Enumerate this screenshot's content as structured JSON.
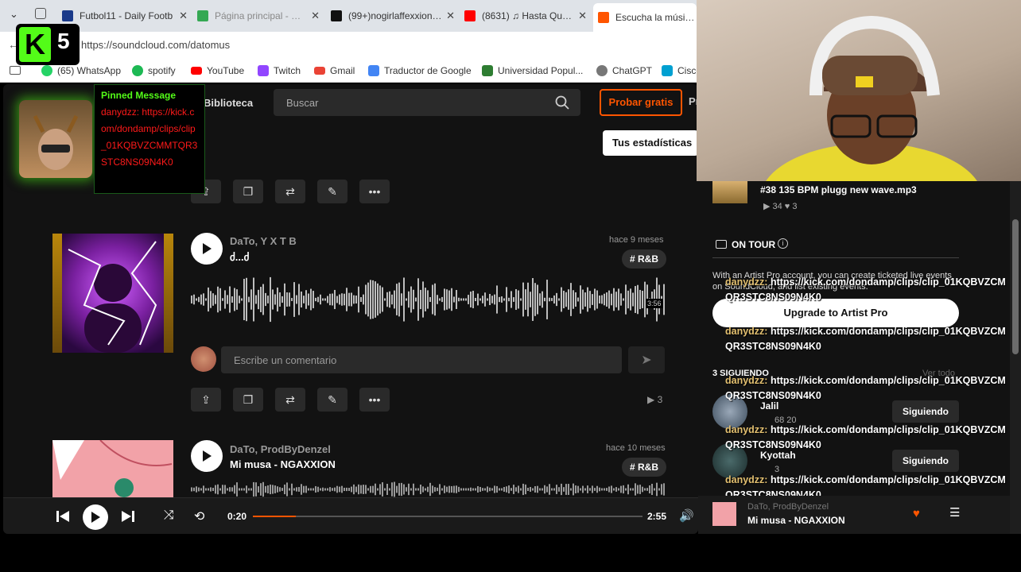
{
  "browser": {
    "tabs": [
      {
        "label": "Futbol11 - Daily Footb",
        "color": "#1a3a8a"
      },
      {
        "label": "Página principal - Goo",
        "color": "#34a853"
      },
      {
        "label": "(99+)nogirlaffexxion (@",
        "color": "#111111"
      },
      {
        "label": "(8631) ♫ Hasta Que Te",
        "color": "#ff0000"
      },
      {
        "label": "Escucha la música de",
        "color": "#ff5500"
      }
    ],
    "url": "https://soundcloud.com/datomus",
    "bookmarks": [
      {
        "label": "(65) WhatsApp",
        "color": "#25d366"
      },
      {
        "label": "spotify",
        "color": "#1db954"
      },
      {
        "label": "YouTube",
        "color": "#ff0000"
      },
      {
        "label": "Twitch",
        "color": "#9146ff"
      },
      {
        "label": "Gmail",
        "color": "#ea4335"
      },
      {
        "label": "Traductor de Google",
        "color": "#4285f4"
      },
      {
        "label": "Universidad Popul...",
        "color": "#2e7d32"
      },
      {
        "label": "ChatGPT",
        "color": "#777777"
      },
      {
        "label": "Cisco",
        "color": "#00a0d1"
      }
    ]
  },
  "sc": {
    "library": "Biblioteca",
    "search_placeholder": "Buscar",
    "try_free": "Probar gratis",
    "pr": "Pr",
    "stats_popup": "Tus estadísticas",
    "track1": {
      "artist": "DaTo, Y X T B",
      "title": "ძ...ძ",
      "ago": "hace 9 meses",
      "tag": "# R&B",
      "duration": "3:56",
      "plays": "▶ 3"
    },
    "comment_placeholder": "Escribe un comentario",
    "track2": {
      "artist": "DaTo, ProdByDenzel",
      "title": "Mi musa - NGAXXION",
      "ago": "hace 10 meses",
      "tag": "# R&B"
    }
  },
  "player": {
    "elapsed": "0:20",
    "total": "2:55",
    "progress": 0.11,
    "now_artist": "DaTo, ProdByDenzel",
    "now_title": "Mi musa - NGAXXION"
  },
  "right": {
    "top_track": "#38 135 BPM plugg new wave.mp3",
    "top_stats": "▶ 34   ♥ 3",
    "on_tour": "ON TOUR",
    "on_tour_text": "With an Artist Pro account, you can create ticketed live events on SoundCloud, and list existing events.",
    "upgrade": "Upgrade to Artist Pro",
    "following": "3 SIGUIENDO",
    "see_all": "Ver todo",
    "follow1": {
      "name": "Jalil",
      "stats": "68   20",
      "btn": "Siguiendo"
    },
    "follow2": {
      "name": "Kyottah",
      "stats": "3",
      "btn": "Siguiendo"
    }
  },
  "chat": [
    {
      "user": "danydzz:",
      "text": " https://kick.com/dondamp/clips/clip_01KQBVZCM",
      "cont": "QR3STC8NS09N4K0"
    },
    {
      "user": "danydzz:",
      "text": " https://kick.com/dondamp/clips/clip_01KQBVZCM",
      "cont": "QR3STC8NS09N4K0"
    },
    {
      "user": "danydzz:",
      "text": " https://kick.com/dondamp/clips/clip_01KQBVZCM",
      "cont": "QR3STC8NS09N4K0"
    },
    {
      "user": "danydzz:",
      "text": " https://kick.com/dondamp/clips/clip_01KQBVZCM",
      "cont": "QR3STC8NS09N4K0"
    },
    {
      "user": "danydzz:",
      "text": " https://kick.com/dondamp/clips/clip_01KQBVZCM",
      "cont": "QR3STC8NS09N4K0"
    }
  ],
  "overlay": {
    "logo_k": "K",
    "logo_num": "5",
    "pinned_title": "Pinned Message",
    "pinned_body": "danydzz: https://kick.com/dondamp/clips/clip_01KQBVZCMMTQR3STC8NS09N4K0"
  }
}
